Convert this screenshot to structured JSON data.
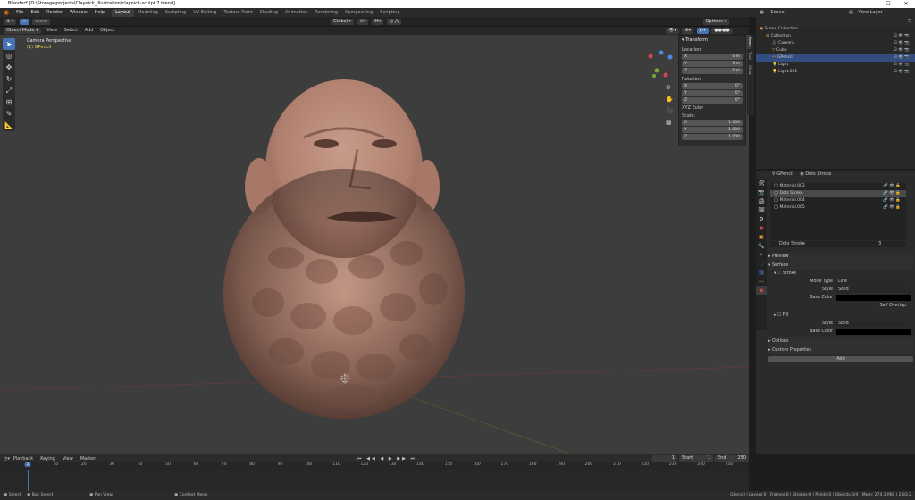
{
  "window": {
    "title": "Blender* [D:\\Storage\\projects\\Claynick_Illustration\\claynick-sculpt 7.blend]",
    "minimize": "—",
    "maximize": "☐",
    "close": "✕"
  },
  "menu": [
    "File",
    "Edit",
    "Render",
    "Window",
    "Help"
  ],
  "workspaces": [
    "Layout",
    "Modeling",
    "Sculpting",
    "UV Editing",
    "Texture Paint",
    "Shading",
    "Animation",
    "Rendering",
    "Compositing",
    "Scripting"
  ],
  "scene": {
    "label": "Scene",
    "view_layer": "View Layer"
  },
  "viewport_header": {
    "mode": "Object Mode",
    "view": "View",
    "select": "Select",
    "add": "Add",
    "object": "Object",
    "transform_orientation": "Global",
    "options": "Options"
  },
  "viewport": {
    "camera_label": "Camera Perspective",
    "object_label": "(1) GPencil"
  },
  "transform": {
    "title": "Transform",
    "location_label": "Location:",
    "location": [
      {
        "axis": "X",
        "value": "0 m"
      },
      {
        "axis": "Y",
        "value": "0 m"
      },
      {
        "axis": "Z",
        "value": "0 m"
      }
    ],
    "rotation_label": "Rotation:",
    "rotation": [
      {
        "axis": "X",
        "value": "0°"
      },
      {
        "axis": "Y",
        "value": "0°"
      },
      {
        "axis": "Z",
        "value": "0°"
      }
    ],
    "rotation_mode": "XYZ Euler",
    "scale_label": "Scale:",
    "scale": [
      {
        "axis": "X",
        "value": "1.000"
      },
      {
        "axis": "Y",
        "value": "1.000"
      },
      {
        "axis": "Z",
        "value": "1.000"
      }
    ]
  },
  "ntabs": [
    "Item",
    "Tool",
    "View"
  ],
  "outliner": {
    "items": [
      {
        "label": "Scene Collection",
        "indent": 0
      },
      {
        "label": "Collection",
        "indent": 1
      },
      {
        "label": "Camera",
        "indent": 2
      },
      {
        "label": "Cube",
        "indent": 2
      },
      {
        "label": "GPencil",
        "indent": 2,
        "selected": true
      },
      {
        "label": "Light",
        "indent": 2
      },
      {
        "label": "Light.001",
        "indent": 2
      }
    ]
  },
  "properties": {
    "object": "GPencil",
    "material_slot": "Dots Stroke",
    "materials": [
      "Material.003",
      "Dots Stroke",
      "Material.004",
      "Material.005"
    ],
    "material_name": "Dots Stroke",
    "user_count": "3",
    "preview": "Preview",
    "surface": "Surface",
    "stroke": "Stroke",
    "mode_type_label": "Mode Type",
    "mode_type_value": "Line",
    "style_label": "Style",
    "style_value": "Solid",
    "base_color_label": "Base Color",
    "self_overlap": "Self Overlap",
    "fill": "Fill",
    "fill_style_label": "Style",
    "fill_style_value": "Solid",
    "fill_base_color_label": "Base Color",
    "options": "Options",
    "custom_properties": "Custom Properties",
    "add": "Add"
  },
  "timeline": {
    "playback": "Playback",
    "keying": "Keying",
    "view": "View",
    "marker": "Marker",
    "current_frame": "1",
    "start_label": "Start",
    "start": "1",
    "end_label": "End",
    "end": "250",
    "ticks": [
      "1",
      "10",
      "20",
      "30",
      "40",
      "50",
      "60",
      "70",
      "80",
      "90",
      "100",
      "110",
      "120",
      "130",
      "140",
      "150",
      "160",
      "170",
      "180",
      "190",
      "200",
      "210",
      "220",
      "230",
      "240",
      "250"
    ]
  },
  "status": {
    "select": "Select",
    "box_select": "Box Select",
    "pan_view": "Pan View",
    "context_menu": "Context Menu",
    "stats": "GPencil | Layers:0 | Frames:0 | Strokes:0 | Points:0 | Objects:0/4 | Mem: 274.3 MiB | 2.83.2"
  },
  "colors": {
    "accent": "#4772b3",
    "viewport_bg": "#3d3d3d",
    "clay": "#b9897a",
    "base_color": "#000000"
  }
}
